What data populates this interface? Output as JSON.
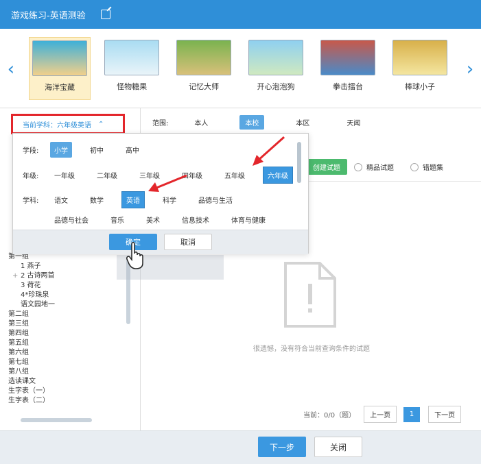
{
  "window": {
    "title": "游戏练习-英语测验",
    "edit_icon": "edit-icon"
  },
  "games": [
    {
      "label": "海洋宝藏",
      "selected": true,
      "color": "#4bb6d8"
    },
    {
      "label": "怪物糖果",
      "selected": false,
      "color": "#9bd2ea"
    },
    {
      "label": "记忆大师",
      "selected": false,
      "color": "#6fa64a"
    },
    {
      "label": "开心泡泡狗",
      "selected": false,
      "color": "#8fd0f0"
    },
    {
      "label": "拳击擂台",
      "selected": false,
      "color": "#c85a4a"
    },
    {
      "label": "棒球小子",
      "selected": false,
      "color": "#d8b04a"
    }
  ],
  "left": {
    "subject_button": "当前学科：六年级英语",
    "tree": [
      {
        "text": "第一组",
        "sub": false
      },
      {
        "text": "1 燕子",
        "sub": true
      },
      {
        "text": "2 古诗两首",
        "sub": true,
        "expandable": true
      },
      {
        "text": "3 荷花",
        "sub": true
      },
      {
        "text": "4*珍珠泉",
        "sub": true
      },
      {
        "text": "语文园地一",
        "sub": true
      },
      {
        "text": "第二组",
        "sub": false
      },
      {
        "text": "第三组",
        "sub": false
      },
      {
        "text": "第四组",
        "sub": false
      },
      {
        "text": "第五组",
        "sub": false
      },
      {
        "text": "第六组",
        "sub": false
      },
      {
        "text": "第七组",
        "sub": false
      },
      {
        "text": "第八组",
        "sub": false
      },
      {
        "text": "选读课文",
        "sub": false
      },
      {
        "text": "生字表（一）",
        "sub": false
      },
      {
        "text": "生字表（二）",
        "sub": false
      }
    ]
  },
  "right": {
    "scope_label": "范围:",
    "scope_options": [
      {
        "label": "本人",
        "active": false
      },
      {
        "label": "本校",
        "active": true
      },
      {
        "label": "本区",
        "active": false
      },
      {
        "label": "天闻",
        "active": false
      }
    ],
    "create_button": "创建试题",
    "filter_1": "精品试题",
    "filter_2": "错题集",
    "empty_text": "很遗憾，没有符合当前查询条件的试题",
    "pager": {
      "info": "当前：0/0（题）",
      "prev": "上一页",
      "page": "1",
      "next": "下一页"
    }
  },
  "popup": {
    "stage_label": "学段:",
    "stages": [
      {
        "label": "小学",
        "active": true
      },
      {
        "label": "初中",
        "active": false
      },
      {
        "label": "高中",
        "active": false
      }
    ],
    "grade_label": "年级:",
    "grades": [
      {
        "label": "一年级",
        "active": false
      },
      {
        "label": "二年级",
        "active": false
      },
      {
        "label": "三年级",
        "active": false
      },
      {
        "label": "四年级",
        "active": false
      },
      {
        "label": "五年级",
        "active": false
      },
      {
        "label": "六年级",
        "active": true
      }
    ],
    "subject_label": "学科:",
    "subjects_row1": [
      {
        "label": "语文",
        "active": false
      },
      {
        "label": "数学",
        "active": false
      },
      {
        "label": "英语",
        "active": true
      },
      {
        "label": "科学",
        "active": false
      },
      {
        "label": "品德与生活",
        "active": false
      }
    ],
    "subjects_row2": [
      {
        "label": "品德与社会",
        "active": false
      },
      {
        "label": "音乐",
        "active": false
      },
      {
        "label": "美术",
        "active": false
      },
      {
        "label": "信息技术",
        "active": false
      },
      {
        "label": "体育与健康",
        "active": false
      }
    ],
    "ok": "确定",
    "cancel": "取消"
  },
  "bottom": {
    "next": "下一步",
    "close": "关闭"
  },
  "colors": {
    "brand": "#2f8fd8",
    "active": "#5aa7e2",
    "highlight": "#e3262b",
    "green": "#4cba6e"
  }
}
